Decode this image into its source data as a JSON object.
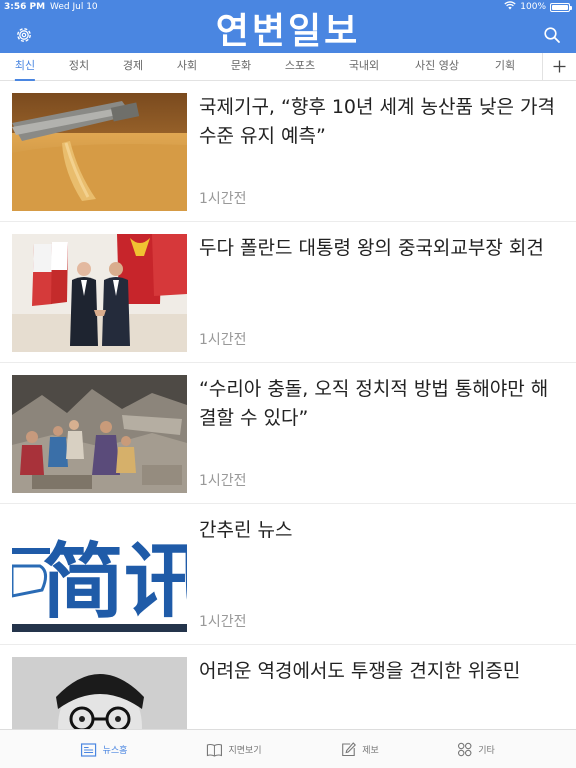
{
  "status_bar": {
    "time": "3:56 PM",
    "date": "Wed Jul 10",
    "battery": "100%"
  },
  "header": {
    "title": "연변일보",
    "left_icon": "settings-icon",
    "right_icon": "search-icon",
    "background": "#4a86e1"
  },
  "tabs": [
    {
      "label": "최신",
      "active": true
    },
    {
      "label": "정치"
    },
    {
      "label": "경제"
    },
    {
      "label": "사회"
    },
    {
      "label": "문화"
    },
    {
      "label": "스포츠"
    },
    {
      "label": "국내외"
    },
    {
      "label": "사진 영상"
    },
    {
      "label": "기획"
    }
  ],
  "tab_add_icon": "plus-icon",
  "articles": [
    {
      "headline": "국제기구, “향후 10년 세계 농산품 낮은 가격수준 유지 예측”",
      "time": "1시간전"
    },
    {
      "headline": "두다 폴란드 대통령 왕의 중국외교부장 회견",
      "time": "1시간전"
    },
    {
      "headline": "“수리아 충돌, 오직 정치적 방법 통해야만 해결할 수 있다”",
      "time": "1시간전"
    },
    {
      "headline": "간추린 뉴스",
      "time": "1시간전",
      "image_text": "简讯"
    },
    {
      "headline": "어려운 역경에서도 투쟁을 견지한 위증민",
      "time": ""
    }
  ],
  "bottom_nav": [
    {
      "label": "뉴스홈",
      "icon": "news-home-icon",
      "active": true
    },
    {
      "label": "지면보기",
      "icon": "book-icon"
    },
    {
      "label": "제보",
      "icon": "edit-icon"
    },
    {
      "label": "기타",
      "icon": "grid-icon"
    }
  ],
  "colors": {
    "accent": "#4a86e1",
    "muted_text": "#999999"
  }
}
